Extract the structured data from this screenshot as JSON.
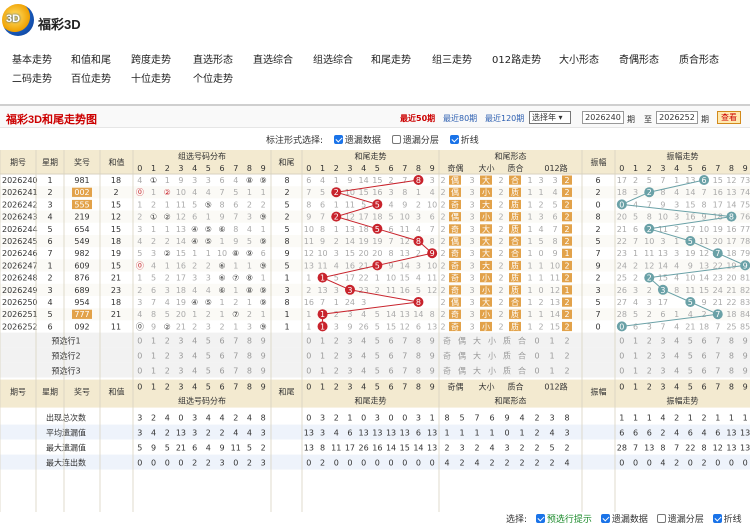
{
  "site": {
    "logo_text": "3D",
    "title": "福彩3D"
  },
  "nav": [
    "基本走势",
    "和值和尾",
    "跨度走势",
    "直选形态",
    "直选综合",
    "组选综合",
    "和尾走势",
    "组三走势",
    "012路走势",
    "大小形态",
    "奇偶形态",
    "质合形态",
    "二码走势",
    "百位走势",
    "十位走势",
    "个位走势"
  ],
  "toolbar": {
    "page_title": "福彩3D和尾走势图",
    "ranges": [
      "最近50期",
      "最近80期",
      "最近120期"
    ],
    "select": "选择年 ▾",
    "from": "2026240",
    "from_suffix": "期",
    "to_label": "至",
    "to": "2026252",
    "to_suffix": "期",
    "query": "查看"
  },
  "options": {
    "label": "标注形式选择:",
    "items": [
      {
        "label": "遗漏数据",
        "checked": true
      },
      {
        "label": "遗漏分层",
        "checked": false
      },
      {
        "label": "折线",
        "checked": true
      }
    ]
  },
  "footer": {
    "label": "选择:",
    "items": [
      {
        "label": "预选行提示",
        "checked": true,
        "green": true
      },
      {
        "label": "遗漏数据",
        "checked": true
      },
      {
        "label": "遗漏分层",
        "checked": false
      },
      {
        "label": "折线",
        "checked": true
      }
    ]
  },
  "colors": {
    "red": "#c8232c",
    "blue": "#6aa1a7",
    "orange": "#e2a24a",
    "header": "#f3ead0",
    "grid": "#d8d2c0"
  },
  "table": {
    "header1": [
      "期号",
      "星期",
      "奖号",
      "和值",
      "组选号码分布",
      "和尾",
      "和尾走势",
      "和尾形态",
      "振幅",
      "振幅走势"
    ],
    "digits": [
      "0",
      "1",
      "2",
      "3",
      "4",
      "5",
      "6",
      "7",
      "8",
      "9"
    ],
    "form_sub": [
      "奇偶",
      "大小",
      "质合",
      "012路"
    ],
    "rows": [
      {
        "issue": "2026240",
        "week": "1",
        "num": "981",
        "sum": "18",
        "grp": [
          "4",
          "①",
          "1",
          "9",
          "3",
          "3",
          "6",
          "4",
          "⑧",
          "⑨"
        ],
        "tail": "8",
        "tt": [
          "6",
          "4",
          "1",
          "9",
          "14",
          "15",
          "2",
          "7",
          "8",
          "3"
        ],
        "oe": "偶",
        "bs": "大",
        "pc": "合",
        "m": [
          "3",
          "3",
          "2"
        ],
        "amp": "6",
        "at": [
          "17",
          "2",
          "5",
          "7",
          "1",
          "13",
          "6",
          "15",
          "12",
          "73"
        ]
      },
      {
        "issue": "2026241",
        "week": "2",
        "num": "002",
        "sum": "2",
        "grp": [
          "⓪",
          "1",
          "②",
          "10",
          "4",
          "4",
          "7",
          "5",
          "1",
          "1"
        ],
        "tail": "2",
        "tt": [
          "7",
          "5",
          "2",
          "10",
          "15",
          "16",
          "3",
          "8",
          "1",
          "4"
        ],
        "oe": "偶",
        "bs": "小",
        "pc": "质",
        "m": [
          "1",
          "4",
          "2"
        ],
        "amp": "2",
        "at": [
          "18",
          "3",
          "2",
          "8",
          "4",
          "14",
          "7",
          "16",
          "13",
          "74"
        ]
      },
      {
        "issue": "2026242",
        "week": "3",
        "num": "555",
        "sum": "15",
        "grp": [
          "1",
          "2",
          "1",
          "11",
          "5",
          "⑤",
          "8",
          "6",
          "2",
          "2"
        ],
        "tail": "5",
        "tt": [
          "8",
          "6",
          "1",
          "11",
          "5",
          "17",
          "4",
          "9",
          "2",
          "10"
        ],
        "oe": "奇",
        "bs": "大",
        "pc": "质",
        "m": [
          "2",
          "5",
          "2"
        ],
        "amp": "0",
        "at": [
          "19",
          "4",
          "7",
          "9",
          "3",
          "15",
          "8",
          "17",
          "14",
          "75"
        ]
      },
      {
        "issue": "2026243",
        "week": "4",
        "num": "219",
        "sum": "12",
        "grp": [
          "2",
          "①",
          "②",
          "12",
          "6",
          "1",
          "9",
          "7",
          "3",
          "⑨"
        ],
        "tail": "2",
        "tt": [
          "9",
          "7",
          "2",
          "12",
          "17",
          "18",
          "5",
          "10",
          "3",
          "6"
        ],
        "oe": "偶",
        "bs": "小",
        "pc": "质",
        "m": [
          "3",
          "6",
          "2"
        ],
        "amp": "8",
        "at": [
          "20",
          "5",
          "8",
          "10",
          "3",
          "16",
          "9",
          "18",
          "15",
          "76"
        ]
      },
      {
        "issue": "2026244",
        "week": "5",
        "num": "654",
        "sum": "15",
        "grp": [
          "3",
          "1",
          "1",
          "13",
          "④",
          "⑤",
          "⑥",
          "8",
          "4",
          "1"
        ],
        "tail": "5",
        "tt": [
          "10",
          "8",
          "1",
          "13",
          "18",
          "5",
          "6",
          "11",
          "4",
          "7"
        ],
        "oe": "奇",
        "bs": "大",
        "pc": "质",
        "m": [
          "4",
          "7",
          "2"
        ],
        "amp": "2",
        "at": [
          "21",
          "6",
          "9",
          "11",
          "2",
          "17",
          "10",
          "19",
          "16",
          "77"
        ]
      },
      {
        "issue": "2026245",
        "week": "6",
        "num": "549",
        "sum": "18",
        "grp": [
          "4",
          "2",
          "2",
          "14",
          "④",
          "⑤",
          "1",
          "9",
          "5",
          "⑨"
        ],
        "tail": "8",
        "tt": [
          "11",
          "9",
          "2",
          "14",
          "19",
          "19",
          "7",
          "12",
          "8",
          "8"
        ],
        "oe": "偶",
        "bs": "大",
        "pc": "合",
        "m": [
          "5",
          "8",
          "2"
        ],
        "amp": "5",
        "at": [
          "22",
          "7",
          "10",
          "3",
          "1",
          "18",
          "11",
          "20",
          "17",
          "78"
        ]
      },
      {
        "issue": "2026246",
        "week": "7",
        "num": "982",
        "sum": "19",
        "grp": [
          "5",
          "3",
          "②",
          "15",
          "1",
          "1",
          "10",
          "⑧",
          "⑨",
          "6"
        ],
        "tail": "9",
        "tt": [
          "12",
          "10",
          "3",
          "15",
          "20",
          "20",
          "8",
          "13",
          "2",
          "9"
        ],
        "oe": "奇",
        "bs": "大",
        "pc": "合",
        "m": [
          "0",
          "9",
          "1"
        ],
        "amp": "7",
        "at": [
          "23",
          "1",
          "11",
          "13",
          "3",
          "19",
          "12",
          "21",
          "18",
          "79"
        ]
      },
      {
        "issue": "2026247",
        "week": "1",
        "num": "609",
        "sum": "15",
        "grp": [
          "⓪",
          "4",
          "1",
          "16",
          "2",
          "2",
          "⑥",
          "1",
          "1",
          "⑨"
        ],
        "tail": "5",
        "tt": [
          "13",
          "11",
          "4",
          "16",
          "21",
          "5",
          "9",
          "14",
          "3",
          "10"
        ],
        "oe": "奇",
        "bs": "大",
        "pc": "质",
        "m": [
          "1",
          "10",
          "2"
        ],
        "amp": "9",
        "at": [
          "24",
          "2",
          "12",
          "14",
          "4",
          "9",
          "13",
          "22",
          "19",
          "80"
        ]
      },
      {
        "issue": "2026248",
        "week": "2",
        "num": "876",
        "sum": "21",
        "grp": [
          "1",
          "5",
          "2",
          "17",
          "3",
          "3",
          "⑥",
          "⑦",
          "⑧",
          "1"
        ],
        "tail": "1",
        "tt": [
          "1",
          "12",
          "5",
          "17",
          "22",
          "1",
          "10",
          "15",
          "4",
          "11"
        ],
        "oe": "奇",
        "bs": "小",
        "pc": "质",
        "m": [
          "1",
          "11",
          "2"
        ],
        "amp": "2",
        "at": [
          "25",
          "2",
          "13",
          "15",
          "4",
          "10",
          "14",
          "23",
          "20",
          "81"
        ]
      },
      {
        "issue": "2026249",
        "week": "3",
        "num": "689",
        "sum": "23",
        "grp": [
          "2",
          "6",
          "3",
          "18",
          "4",
          "4",
          "⑥",
          "1",
          "⑧",
          "⑨"
        ],
        "tail": "3",
        "tt": [
          "2",
          "13",
          "3",
          "18",
          "23",
          "2",
          "11",
          "16",
          "5",
          "12"
        ],
        "oe": "奇",
        "bs": "小",
        "pc": "质",
        "m": [
          "0",
          "12",
          "1"
        ],
        "amp": "3",
        "at": [
          "26",
          "3",
          "2",
          "16",
          "8",
          "11",
          "15",
          "24",
          "21",
          "82"
        ]
      },
      {
        "issue": "2026250",
        "week": "4",
        "num": "954",
        "sum": "18",
        "grp": [
          "3",
          "7",
          "4",
          "19",
          "④",
          "⑤",
          "1",
          "2",
          "1",
          "⑨"
        ],
        "tail": "8",
        "tt": [
          "16",
          "7",
          "1",
          "24",
          "3",
          "",
          "",
          "",
          "8",
          ""
        ],
        "oe": "偶",
        "bs": "大",
        "pc": "合",
        "m": [
          "2",
          "13",
          "2"
        ],
        "amp": "5",
        "at": [
          "27",
          "4",
          "3",
          "17",
          "",
          "5",
          "9",
          "21",
          "22",
          "83"
        ]
      },
      {
        "issue": "2026251",
        "week": "5",
        "num": "777",
        "sum": "21",
        "grp": [
          "4",
          "8",
          "5",
          "20",
          "1",
          "2",
          "1",
          "⑦",
          "2",
          "1"
        ],
        "tail": "1",
        "tt": [
          "1",
          "15",
          "2",
          "3",
          "4",
          "5",
          "14",
          "13",
          "14",
          "8"
        ],
        "oe": "奇",
        "bs": "小",
        "pc": "质",
        "m": [
          "1",
          "14",
          "2"
        ],
        "amp": "7",
        "at": [
          "28",
          "5",
          "2",
          "6",
          "1",
          "4",
          "2",
          "7",
          "18",
          "84"
        ]
      },
      {
        "issue": "2026252",
        "week": "6",
        "num": "092",
        "sum": "11",
        "grp": [
          "⓪",
          "9",
          "②",
          "21",
          "2",
          "3",
          "2",
          "1",
          "3",
          "⑨"
        ],
        "tail": "1",
        "tt": [
          "1",
          "16",
          "3",
          "9",
          "26",
          "5",
          "15",
          "12",
          "6",
          "13"
        ],
        "oe": "奇",
        "bs": "小",
        "pc": "质",
        "m": [
          "2",
          "15",
          "2"
        ],
        "amp": "0",
        "at": [
          "0",
          "6",
          "3",
          "7",
          "4",
          "21",
          "18",
          "7",
          "25",
          "85"
        ]
      }
    ],
    "presel": [
      "预选行1",
      "预选行2",
      "预选行3"
    ],
    "bottom_labels": [
      "出现总次数",
      "平均遗漏值",
      "最大遗漏值",
      "最大连出数"
    ],
    "bottom": {
      "grp": [
        [
          "3",
          "2",
          "4",
          "0",
          "3",
          "4",
          "4",
          "2",
          "4",
          "8"
        ],
        [
          "3",
          "4",
          "2",
          "13",
          "3",
          "2",
          "2",
          "4",
          "4",
          "3"
        ],
        [
          "5",
          "9",
          "5",
          "21",
          "6",
          "4",
          "9",
          "11",
          "5",
          "2"
        ],
        [
          "0",
          "0",
          "0",
          "0",
          "2",
          "2",
          "3",
          "0",
          "2",
          "3"
        ]
      ],
      "tt": [
        [
          "0",
          "3",
          "2",
          "1",
          "0",
          "3",
          "0",
          "0",
          "3",
          "1"
        ],
        [
          "13",
          "3",
          "4",
          "6",
          "13",
          "13",
          "13",
          "13",
          "6",
          "13"
        ],
        [
          "13",
          "8",
          "11",
          "17",
          "26",
          "16",
          "14",
          "15",
          "14",
          "13"
        ],
        [
          "0",
          "2",
          "0",
          "0",
          "0",
          "0",
          "0",
          "0",
          "0",
          "0"
        ]
      ],
      "form": [
        [
          "8",
          "5",
          "7",
          "6",
          "9",
          "4",
          "2",
          "3",
          "8"
        ],
        [
          "1",
          "1",
          "1",
          "1",
          "0",
          "1",
          "2",
          "4",
          "3"
        ],
        [
          "2",
          "3",
          "2",
          "4",
          "3",
          "2",
          "2",
          "5",
          "2"
        ],
        [
          "4",
          "2",
          "4",
          "2",
          "2",
          "2",
          "2",
          "2",
          "4"
        ]
      ],
      "at": [
        [
          "1",
          "1",
          "1",
          "4",
          "2",
          "1",
          "2",
          "1",
          "1",
          "1"
        ],
        [
          "6",
          "6",
          "6",
          "2",
          "4",
          "6",
          "4",
          "6",
          "13",
          "13"
        ],
        [
          "28",
          "7",
          "13",
          "8",
          "7",
          "22",
          "8",
          "12",
          "13",
          "13"
        ],
        [
          "0",
          "0",
          "0",
          "4",
          "2",
          "0",
          "2",
          "0",
          "0",
          "0"
        ]
      ]
    }
  }
}
